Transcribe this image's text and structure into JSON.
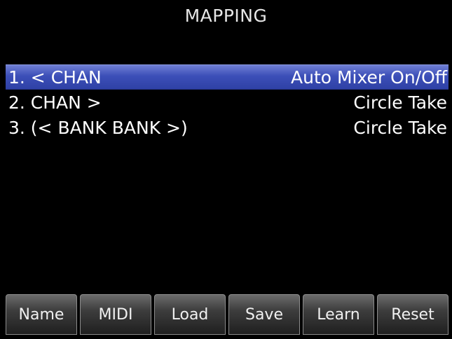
{
  "header": {
    "title": "MAPPING"
  },
  "mappings": [
    {
      "left": "1. < CHAN",
      "right": "Auto Mixer On/Off",
      "selected": true
    },
    {
      "left": "2. CHAN >",
      "right": "Circle Take",
      "selected": false
    },
    {
      "left": "3. (< BANK BANK >)",
      "right": "Circle Take",
      "selected": false
    }
  ],
  "softkeys": {
    "name": "Name",
    "midi": "MIDI",
    "load": "Load",
    "save": "Save",
    "learn": "Learn",
    "reset": "Reset"
  },
  "colors": {
    "background": "#000000",
    "selection": "#3c4fb8",
    "text": "#ffffff"
  }
}
